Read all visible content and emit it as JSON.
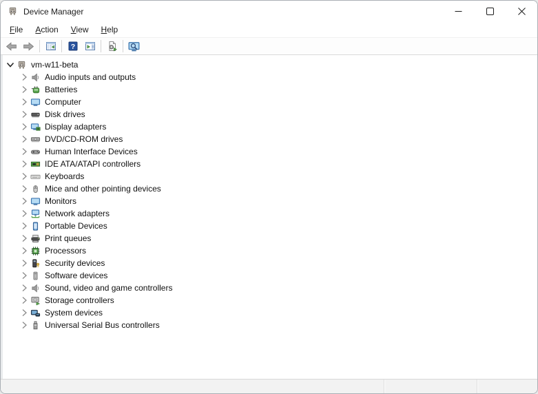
{
  "window": {
    "title": "Device Manager",
    "icon": "device-manager-icon",
    "controls": [
      {
        "name": "minimize"
      },
      {
        "name": "maximize"
      },
      {
        "name": "close"
      }
    ]
  },
  "menu": {
    "items": [
      {
        "label": "File"
      },
      {
        "label": "Action"
      },
      {
        "label": "View"
      },
      {
        "label": "Help"
      }
    ]
  },
  "toolbar": {
    "buttons": [
      {
        "type": "button",
        "name": "back",
        "icon": "back-arrow-icon"
      },
      {
        "type": "button",
        "name": "forward",
        "icon": "forward-arrow-icon"
      },
      {
        "type": "separator"
      },
      {
        "type": "button",
        "name": "show-hide-console-tree",
        "icon": "console-tree-icon"
      },
      {
        "type": "separator"
      },
      {
        "type": "button",
        "name": "help",
        "icon": "help-icon"
      },
      {
        "type": "button",
        "name": "show-hide-action-pane",
        "icon": "action-pane-icon"
      },
      {
        "type": "separator"
      },
      {
        "type": "button",
        "name": "scan-for-hardware-changes",
        "icon": "scan-hardware-icon"
      },
      {
        "type": "separator"
      },
      {
        "type": "button",
        "name": "device-search",
        "icon": "computer-search-icon"
      }
    ]
  },
  "tree": {
    "root": {
      "label": "vm-w11-beta",
      "icon": "device-manager-icon",
      "expanded": true
    },
    "items": [
      {
        "label": "Audio inputs and outputs",
        "icon": "speaker-icon"
      },
      {
        "label": "Batteries",
        "icon": "battery-icon"
      },
      {
        "label": "Computer",
        "icon": "computer-icon"
      },
      {
        "label": "Disk drives",
        "icon": "disk-drive-icon"
      },
      {
        "label": "Display adapters",
        "icon": "display-adapter-icon"
      },
      {
        "label": "DVD/CD-ROM drives",
        "icon": "dvd-drive-icon"
      },
      {
        "label": "Human Interface Devices",
        "icon": "gamepad-icon"
      },
      {
        "label": "IDE ATA/ATAPI controllers",
        "icon": "ide-controller-icon"
      },
      {
        "label": "Keyboards",
        "icon": "keyboard-icon"
      },
      {
        "label": "Mice and other pointing devices",
        "icon": "mouse-icon"
      },
      {
        "label": "Monitors",
        "icon": "monitor-icon"
      },
      {
        "label": "Network adapters",
        "icon": "network-adapter-icon"
      },
      {
        "label": "Portable Devices",
        "icon": "portable-device-icon"
      },
      {
        "label": "Print queues",
        "icon": "printer-icon"
      },
      {
        "label": "Processors",
        "icon": "processor-icon"
      },
      {
        "label": "Security devices",
        "icon": "security-device-icon"
      },
      {
        "label": "Software devices",
        "icon": "software-device-icon"
      },
      {
        "label": "Sound, video and game controllers",
        "icon": "speaker-icon"
      },
      {
        "label": "Storage controllers",
        "icon": "storage-controller-icon"
      },
      {
        "label": "System devices",
        "icon": "system-device-icon"
      },
      {
        "label": "Universal Serial Bus controllers",
        "icon": "usb-icon"
      }
    ]
  },
  "status_bar": {
    "text": ""
  },
  "colors": {
    "help_blue": "#28529e",
    "icon_green": "#58a44c",
    "monitor_blue": "#7ab8e8",
    "statusbar_bg": "#f2f2f2",
    "window_border": "#a9aeb4"
  }
}
